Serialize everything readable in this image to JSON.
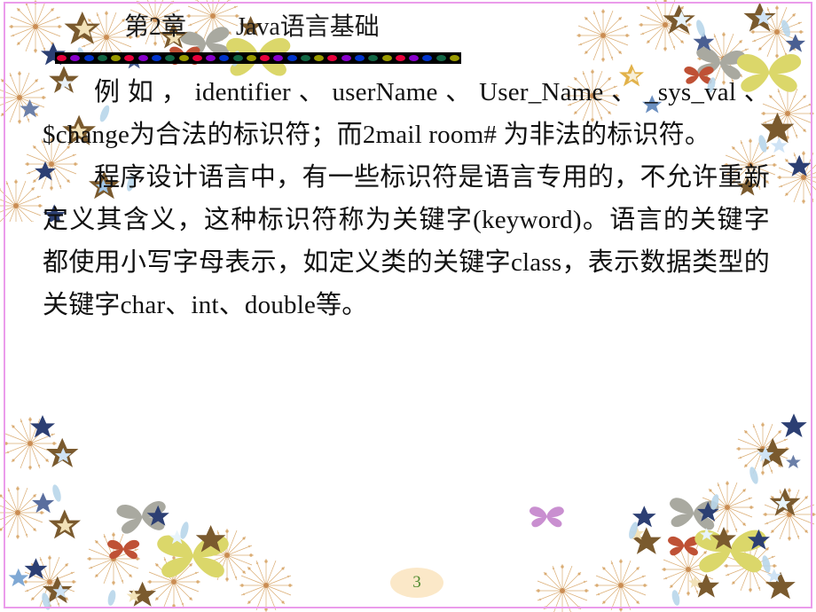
{
  "slide": {
    "title": "第2章        Java语言基础",
    "page_number": "3",
    "border_color": "#eb9ceb",
    "page_number_bg": "#fbe8c8",
    "page_number_color": "#4f8a2e",
    "text_color": "#111111"
  },
  "bead_bar": {
    "background": "#000000",
    "bead_colors": [
      "#e8003c",
      "#8800cc",
      "#0033cc",
      "#116644",
      "#9a9a00"
    ],
    "repeat_count": 6
  },
  "body": {
    "paragraphs": [
      "例如，identifier、userName、User_Name、_sys_val、$change为合法的标识符；而2mail room# 为非法的标识符。",
      "程序设计语言中，有一些标识符是语言专用的，不允许重新定义其含义，这种标识符称为关键字(keyword)。语言的关键字都使用小写字母表示，如定义类的关键字class，表示数据类型的关键字char、int、double等。"
    ]
  },
  "decorations": {
    "corners": [
      "top-left",
      "top-right",
      "bottom-left",
      "bottom-right"
    ],
    "motifs": [
      "butterfly",
      "star",
      "firework-burst"
    ],
    "colors": {
      "butterfly_grey": "#a9a9a0",
      "butterfly_yellow": "#dbd76a",
      "butterfly_orange": "#c0523a",
      "butterfly_violet": "#c98fd0",
      "star_brown": "#7a5a2e",
      "star_navy": "#2c3f73",
      "star_blue": "#7fa8d4",
      "star_cream": "#f2e2b8",
      "burst_tan": "#d9a86c"
    }
  }
}
